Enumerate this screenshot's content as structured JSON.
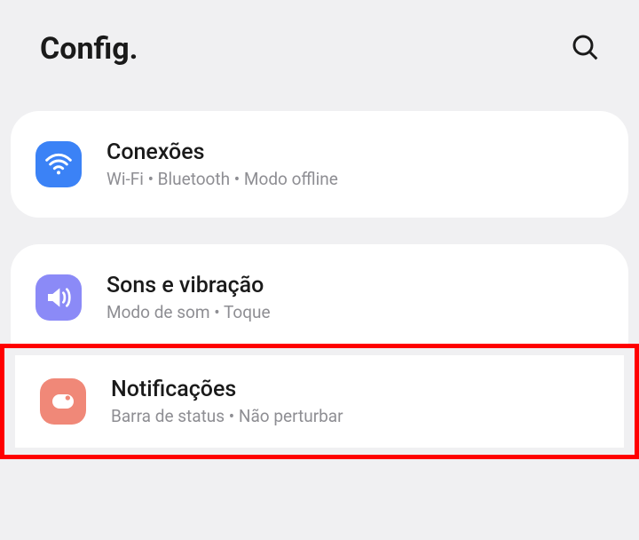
{
  "header": {
    "title": "Config."
  },
  "settings": {
    "connections": {
      "title": "Conexões",
      "subtitle": "Wi-Fi  •  Bluetooth  •  Modo offline"
    },
    "sounds": {
      "title": "Sons e vibração",
      "subtitle": "Modo de som  •  Toque"
    },
    "notifications": {
      "title": "Notificações",
      "subtitle": "Barra de status  •  Não perturbar"
    }
  }
}
